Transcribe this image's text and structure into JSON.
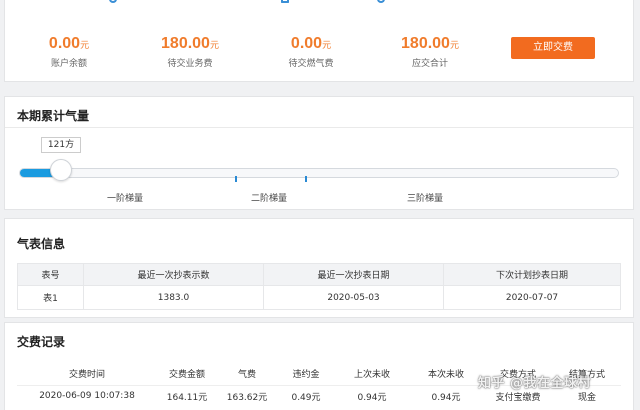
{
  "summary": {
    "stats": [
      {
        "value": "0.00",
        "unit": "元",
        "label": "账户余额"
      },
      {
        "value": "180.00",
        "unit": "元",
        "label": "待交业务费"
      },
      {
        "value": "0.00",
        "unit": "元",
        "label": "待交燃气费"
      },
      {
        "value": "180.00",
        "unit": "元",
        "label": "应交合计"
      }
    ],
    "pay_button": "立即交费"
  },
  "usage": {
    "title": "本期累计气量",
    "current_label": "121方",
    "progress_fraction": 0.07,
    "tiers": [
      "一阶梯量",
      "二阶梯量",
      "三阶梯量"
    ]
  },
  "meter": {
    "title": "气表信息",
    "headers": [
      "表号",
      "最近一次抄表示数",
      "最近一次抄表日期",
      "下次计划抄表日期"
    ],
    "rows": [
      [
        "表1",
        "1383.0",
        "2020-05-03",
        "2020-07-07"
      ]
    ]
  },
  "payments": {
    "title": "交费记录",
    "headers": [
      "交费时间",
      "交费金额",
      "气费",
      "违约金",
      "上次未收",
      "本次未收",
      "交费方式",
      "结算方式"
    ],
    "rows": [
      [
        "2020-06-09 10:07:38",
        "164.11元",
        "163.62元",
        "0.49元",
        "0.94元",
        "0.94元",
        "支付宝缴费",
        "现金"
      ]
    ]
  },
  "watermark": "知乎 @我在全球村"
}
